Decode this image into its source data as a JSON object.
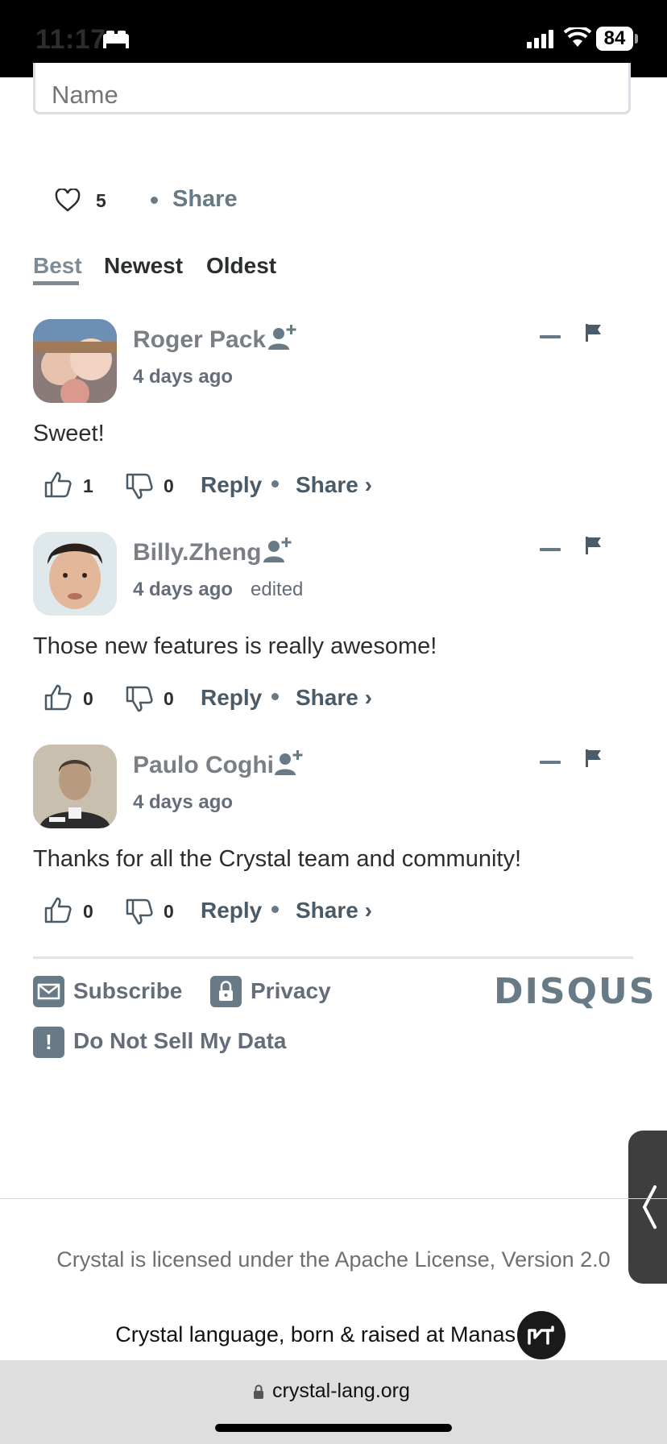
{
  "status_bar": {
    "time": "11:17",
    "battery": "84"
  },
  "form": {
    "name_placeholder": "Name"
  },
  "thread": {
    "likes": "5",
    "share_label": "Share"
  },
  "tabs": [
    {
      "label": "Best",
      "active": true
    },
    {
      "label": "Newest",
      "active": false
    },
    {
      "label": "Oldest",
      "active": false
    }
  ],
  "comments": [
    {
      "author": "Roger Pack",
      "time": "4 days ago",
      "edited": "",
      "text": "Sweet!",
      "upvotes": "1",
      "downvotes": "0",
      "reply_label": "Reply",
      "share_label": "Share ›"
    },
    {
      "author": "Billy.Zheng",
      "time": "4 days ago",
      "edited": "edited",
      "text": "Those new features is really awesome!",
      "upvotes": "0",
      "downvotes": "0",
      "reply_label": "Reply",
      "share_label": "Share ›"
    },
    {
      "author": "Paulo Coghi",
      "time": "4 days ago",
      "edited": "",
      "text": "Thanks for all the Crystal team and community!",
      "upvotes": "0",
      "downvotes": "0",
      "reply_label": "Reply",
      "share_label": "Share ›"
    }
  ],
  "disqus_footer": {
    "subscribe": "Subscribe",
    "privacy": "Privacy",
    "do_not_sell": "Do Not Sell My Data",
    "brand": "DISQUS"
  },
  "page_footer": {
    "license": "Crystal is licensed under the Apache License, Version 2.0",
    "born": "Crystal language, born & raised at Manas"
  },
  "browser": {
    "url": "crystal-lang.org"
  },
  "colors": {
    "accent": "#687a86",
    "text": "#2a2e2e",
    "muted": "#7f8b94"
  }
}
